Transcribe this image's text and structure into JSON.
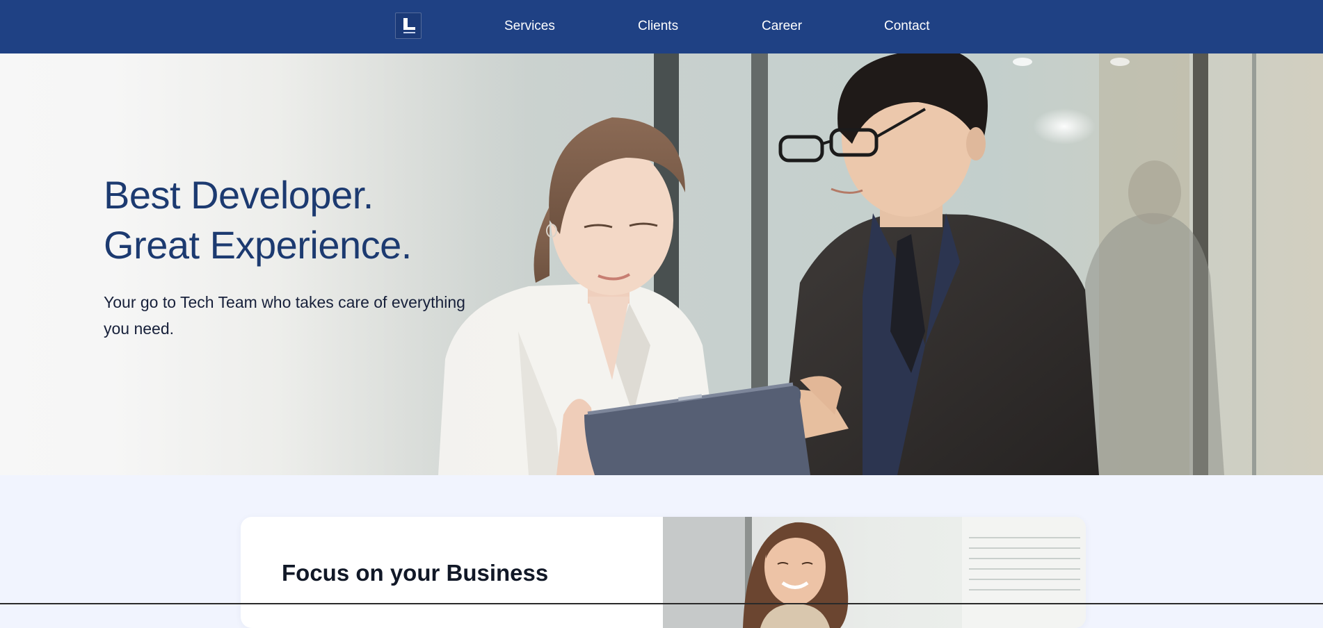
{
  "nav": {
    "logo_name": "L",
    "links": [
      "Services",
      "Clients",
      "Career",
      "Contact"
    ]
  },
  "hero": {
    "title_line1": "Best Developer.",
    "title_line2": "Great Experience.",
    "subtitle": "Your go to Tech Team who takes care of everything you need."
  },
  "focus": {
    "title": "Focus on your Business"
  },
  "colors": {
    "nav_bg": "#1f4184",
    "heading": "#1c3a70",
    "section_bg": "#f1f4fe"
  }
}
